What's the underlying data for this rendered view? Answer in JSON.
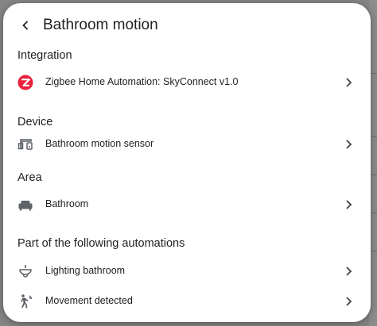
{
  "dialog": {
    "title": "Bathroom motion"
  },
  "sections": {
    "integration": {
      "title": "Integration",
      "item": {
        "label": "Zigbee Home Automation: SkyConnect v1.0",
        "icon": "zigbee-icon"
      }
    },
    "device": {
      "title": "Device",
      "item": {
        "label": "Bathroom motion sensor",
        "icon": "devices-icon"
      }
    },
    "area": {
      "title": "Area",
      "item": {
        "label": "Bathroom",
        "icon": "sofa-icon"
      }
    },
    "automations": {
      "title": "Part of the following automations",
      "items": [
        {
          "label": "Lighting bathroom",
          "icon": "ceiling-light-icon"
        },
        {
          "label": "Movement detected",
          "icon": "motion-sensor-icon"
        }
      ]
    }
  },
  "colors": {
    "zigbee_brand": "#e9233f",
    "icon_gray": "#5f6368",
    "text": "#212121",
    "divider": "#e0e0e0"
  }
}
